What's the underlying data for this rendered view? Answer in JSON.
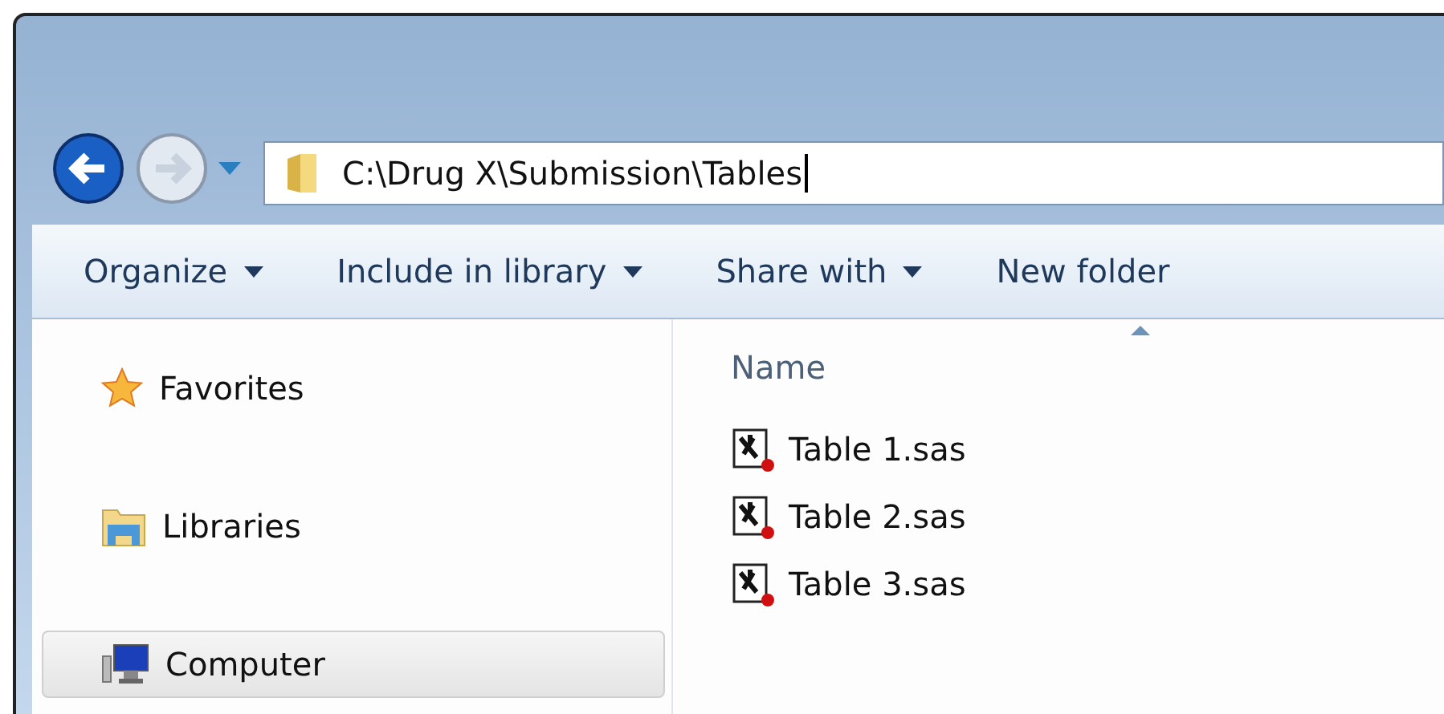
{
  "address_bar": {
    "path": "C:\\Drug X\\Submission\\Tables"
  },
  "toolbar": [
    {
      "label": "Organize",
      "dropdown": true
    },
    {
      "label": "Include in library",
      "dropdown": true
    },
    {
      "label": "Share with",
      "dropdown": true
    },
    {
      "label": "New folder",
      "dropdown": false
    }
  ],
  "sidebar": {
    "items": [
      {
        "label": "Favorites",
        "kind": "favorites",
        "selected": false
      },
      {
        "label": "Libraries",
        "kind": "libraries",
        "selected": false
      },
      {
        "label": "Computer",
        "kind": "computer",
        "selected": true
      }
    ]
  },
  "file_list": {
    "columns": [
      "Name"
    ],
    "rows": [
      {
        "name": "Table 1.sas"
      },
      {
        "name": "Table 2.sas"
      },
      {
        "name": "Table 3.sas"
      }
    ]
  }
}
